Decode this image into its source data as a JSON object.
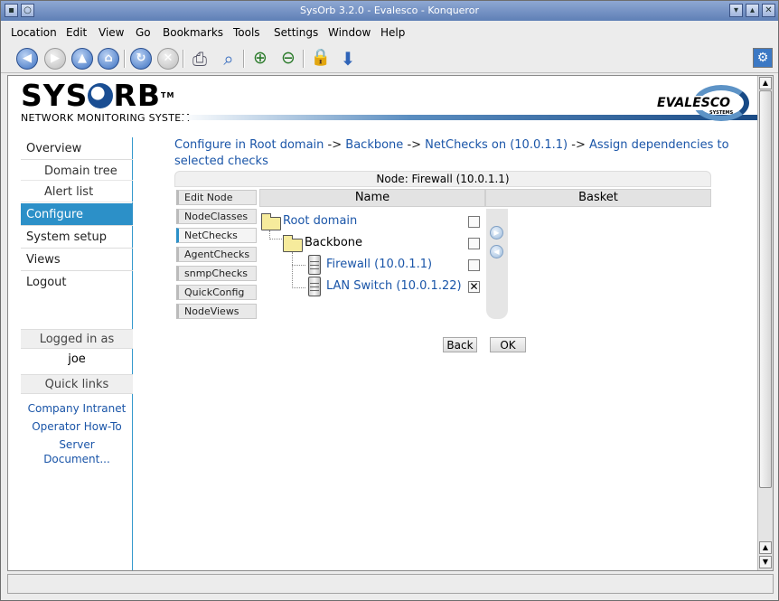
{
  "window": {
    "title": "SysOrb 3.2.0 - Evalesco - Konqueror"
  },
  "menu": [
    "Location",
    "Edit",
    "View",
    "Go",
    "Bookmarks",
    "Tools",
    "Settings",
    "Window",
    "Help"
  ],
  "toolbar_icons": [
    "back-icon",
    "forward-icon",
    "up-icon",
    "home-icon",
    "reload-icon",
    "stop-icon",
    "print-icon",
    "find-icon",
    "zoom-in-icon",
    "zoom-out-icon",
    "lock-icon",
    "download-icon",
    "gear-icon"
  ],
  "header": {
    "logo_text": "SYSORB",
    "logo_tm": "TM",
    "subtitle": "NETWORK MONITORING SYSTEM",
    "partner_logo": "EVALESCO",
    "partner_sub": "SYSTEMS"
  },
  "sidebar": {
    "items": [
      {
        "label": "Overview",
        "sub": false,
        "active": false
      },
      {
        "label": "Domain tree",
        "sub": true,
        "active": false
      },
      {
        "label": "Alert list",
        "sub": true,
        "active": false
      },
      {
        "label": "Configure",
        "sub": false,
        "active": true
      },
      {
        "label": "System setup",
        "sub": false,
        "active": false
      },
      {
        "label": "Views",
        "sub": false,
        "active": false
      },
      {
        "label": "Logout",
        "sub": false,
        "active": false
      }
    ],
    "logged_in_header": "Logged in as",
    "logged_in_user": "joe",
    "quick_links_header": "Quick links",
    "quick_links": [
      "Company Intranet",
      "Operator How-To",
      "Server Document..."
    ]
  },
  "breadcrumb": {
    "parts": [
      "Configure in Root domain",
      "Backbone",
      "NetChecks on (10.0.1.1)",
      "Assign dependencies to selected checks"
    ],
    "separator": "->"
  },
  "node_panel": {
    "title": "Node: Firewall (10.0.1.1)",
    "tabs": [
      "Edit Node",
      "NodeClasses",
      "NetChecks",
      "AgentChecks",
      "snmpChecks",
      "QuickConfig",
      "NodeViews"
    ],
    "active_tab": "NetChecks",
    "col_name": "Name",
    "col_basket": "Basket",
    "tree": [
      {
        "label": "Root domain",
        "type": "folder",
        "link": true,
        "checked": false
      },
      {
        "label": "Backbone",
        "type": "folder",
        "link": false,
        "checked": false
      },
      {
        "label": "Firewall (10.0.1.1)",
        "type": "server",
        "link": true,
        "checked": false
      },
      {
        "label": "LAN Switch (10.0.1.22)",
        "type": "server",
        "link": true,
        "checked": true
      }
    ],
    "back_label": "Back",
    "ok_label": "OK"
  },
  "colors": {
    "accent": "#2c90c8",
    "link": "#1a55a8",
    "brand_blue": "#1b4b85"
  }
}
